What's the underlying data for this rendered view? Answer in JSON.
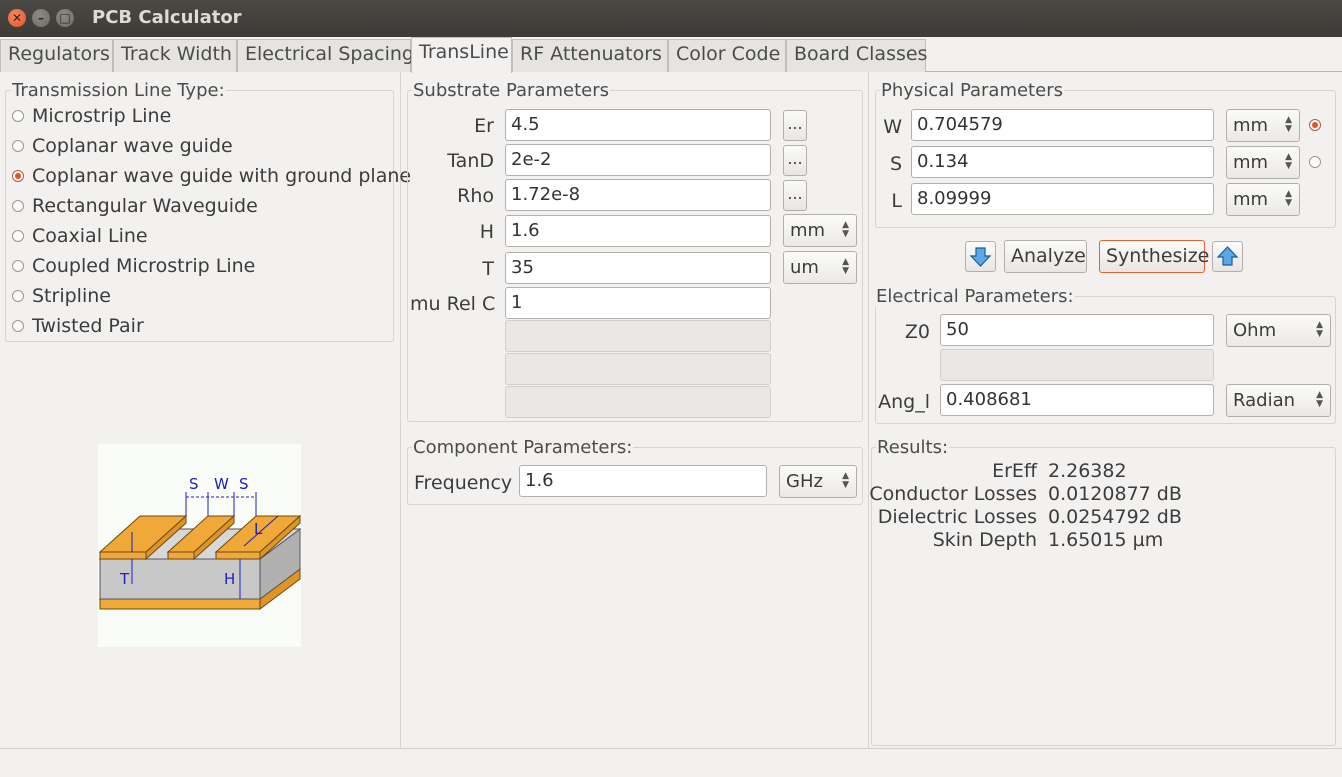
{
  "window": {
    "title": "PCB Calculator"
  },
  "tabs": [
    {
      "label": "Regulators"
    },
    {
      "label": "Track Width"
    },
    {
      "label": "Electrical Spacing"
    },
    {
      "label": "TransLine"
    },
    {
      "label": "RF Attenuators"
    },
    {
      "label": "Color Code"
    },
    {
      "label": "Board Classes"
    }
  ],
  "active_tab": "TransLine",
  "line_type": {
    "title": "Transmission Line Type:",
    "options": [
      {
        "label": "Microstrip Line"
      },
      {
        "label": "Coplanar wave guide"
      },
      {
        "label": "Coplanar wave guide with ground plane"
      },
      {
        "label": "Rectangular Waveguide"
      },
      {
        "label": "Coaxial Line"
      },
      {
        "label": "Coupled Microstrip Line"
      },
      {
        "label": "Stripline"
      },
      {
        "label": "Twisted Pair"
      }
    ],
    "selected": "Coplanar wave guide with ground plane"
  },
  "diagram": {
    "label_s1": "S",
    "label_w": "W",
    "label_s2": "S",
    "label_l": "L",
    "label_t": "T",
    "label_h": "H"
  },
  "substrate": {
    "title": "Substrate Parameters",
    "er": {
      "label": "Er",
      "value": "4.5",
      "button": "..."
    },
    "tand": {
      "label": "TanD",
      "value": "2e-2",
      "button": "..."
    },
    "rho": {
      "label": "Rho",
      "value": "1.72e-8",
      "button": "..."
    },
    "h": {
      "label": "H",
      "value": "1.6",
      "unit": "mm"
    },
    "t": {
      "label": "T",
      "value": "35",
      "unit": "um"
    },
    "murel": {
      "label": "mu Rel C",
      "value": "1"
    }
  },
  "component": {
    "title": "Component Parameters:",
    "frequency": {
      "label": "Frequency",
      "value": "1.6",
      "unit": "GHz"
    }
  },
  "physical": {
    "title": "Physical Parameters",
    "w": {
      "label": "W",
      "value": "0.704579",
      "unit": "mm"
    },
    "s": {
      "label": "S",
      "value": "0.134",
      "unit": "mm"
    },
    "l": {
      "label": "L",
      "value": "8.09999",
      "unit": "mm"
    }
  },
  "actions": {
    "analyze": "Analyze",
    "synthesize": "Synthesize"
  },
  "electrical": {
    "title": "Electrical Parameters:",
    "z0": {
      "label": "Z0",
      "value": "50",
      "unit": "Ohm"
    },
    "angl": {
      "label": "Ang_l",
      "value": "0.408681",
      "unit": "Radian"
    }
  },
  "results": {
    "title": "Results:",
    "items": [
      {
        "label": "ErEff",
        "value": "2.26382"
      },
      {
        "label": "Conductor Losses",
        "value": "0.0120877 dB"
      },
      {
        "label": "Dielectric Losses",
        "value": "0.0254792 dB"
      },
      {
        "label": "Skin Depth",
        "value": "1.65015 µm"
      }
    ]
  },
  "colors": {
    "accent": "#e0522b",
    "titlebar": "#3c3b37",
    "copper": "#f0a838",
    "substrate": "#c8c8c8",
    "dimension": "#2020c0"
  }
}
